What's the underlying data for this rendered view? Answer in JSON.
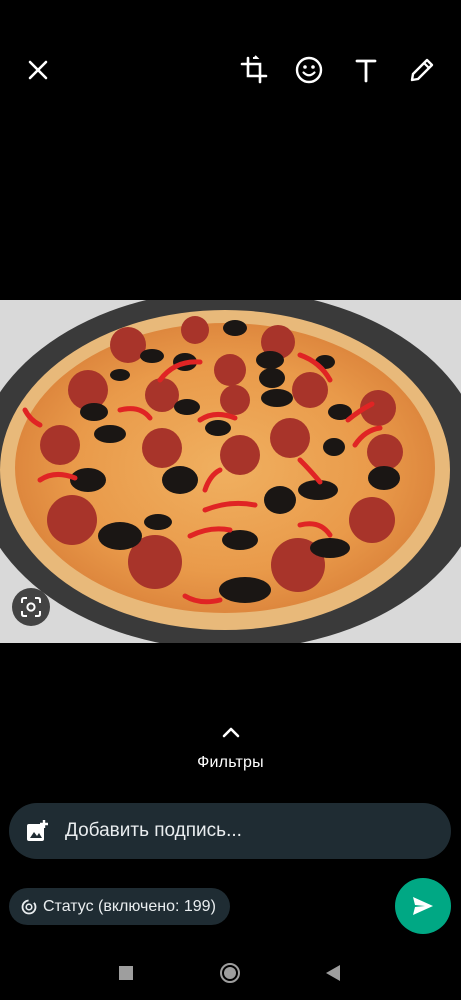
{
  "toolbar": {
    "close_icon": "close-icon",
    "crop_icon": "crop-rotate-icon",
    "emoji_icon": "emoji-icon",
    "text_icon": "text-icon",
    "draw_icon": "pencil-icon"
  },
  "photo": {
    "subject": "pizza",
    "lens_icon": "lens-icon"
  },
  "filters": {
    "label": "Фильтры",
    "icon": "chevron-up-icon"
  },
  "caption": {
    "placeholder": "Добавить подпись...",
    "icon": "add-image-icon"
  },
  "status": {
    "label": "Статус (включено: 199)",
    "icon": "status-icon"
  },
  "send": {
    "icon": "send-icon",
    "color": "#00a884"
  },
  "navigation": {
    "recents_icon": "square-icon",
    "home_icon": "circle-icon",
    "back_icon": "triangle-back-icon"
  },
  "colors": {
    "background": "#000000",
    "input_background": "#1f2c33",
    "accent": "#00a884"
  }
}
